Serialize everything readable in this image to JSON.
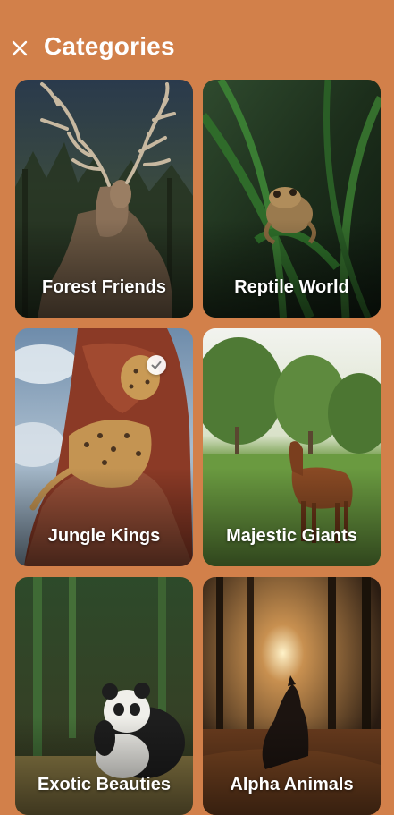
{
  "header": {
    "title": "Categories",
    "close_icon": "close-icon"
  },
  "categories": [
    {
      "label": "Forest Friends",
      "selected": false,
      "image": "deer"
    },
    {
      "label": "Reptile World",
      "selected": false,
      "image": "frog"
    },
    {
      "label": "Jungle Kings",
      "selected": true,
      "image": "leopard"
    },
    {
      "label": "Majestic Giants",
      "selected": false,
      "image": "horse"
    },
    {
      "label": "Exotic Beauties",
      "selected": false,
      "image": "panda"
    },
    {
      "label": "Alpha Animals",
      "selected": false,
      "image": "wolf-forest"
    }
  ],
  "colors": {
    "background": "#D2804A",
    "text": "#FFFFFF"
  }
}
